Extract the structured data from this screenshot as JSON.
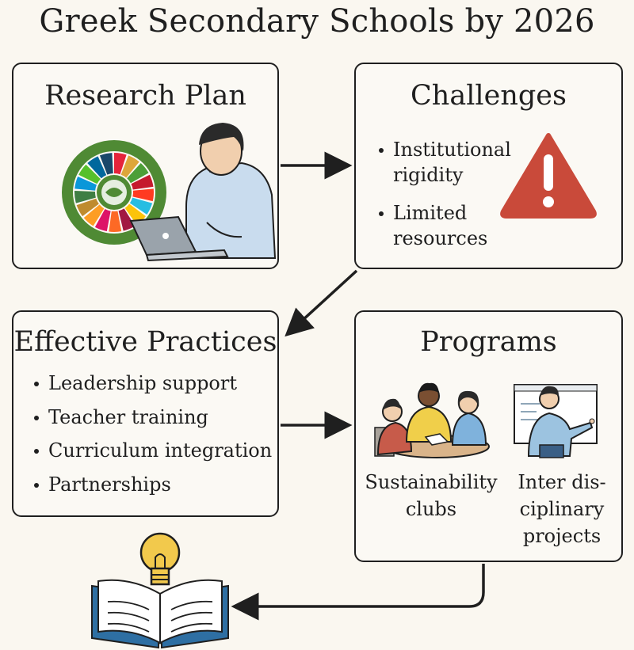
{
  "title": "Greek Secondary Schools by 2026",
  "research_plan": {
    "title": "Research Plan"
  },
  "challenges": {
    "title": "Challenges",
    "items": [
      "Institutional rigidity",
      "Limited resources"
    ]
  },
  "effective_practices": {
    "title": "Effective Practices",
    "items": [
      "Leadership support",
      "Teacher training",
      "Curriculum integration",
      "Partnerships"
    ]
  },
  "programs": {
    "title": "Programs",
    "items": [
      "Sustainability clubs",
      "Inter dis- ciplinary projects"
    ]
  },
  "colors": {
    "box_border": "#1f1f1f",
    "warning_red": "#c94a3a",
    "sdg_ring_green": "#4f8a34",
    "book_blue": "#2e6fa3",
    "bulb_yellow": "#f2c94c"
  },
  "icons": [
    "sdg-wheel-icon",
    "person-laptop-icon",
    "warning-icon",
    "group-table-icon",
    "teacher-whiteboard-icon",
    "book-lightbulb-icon"
  ]
}
